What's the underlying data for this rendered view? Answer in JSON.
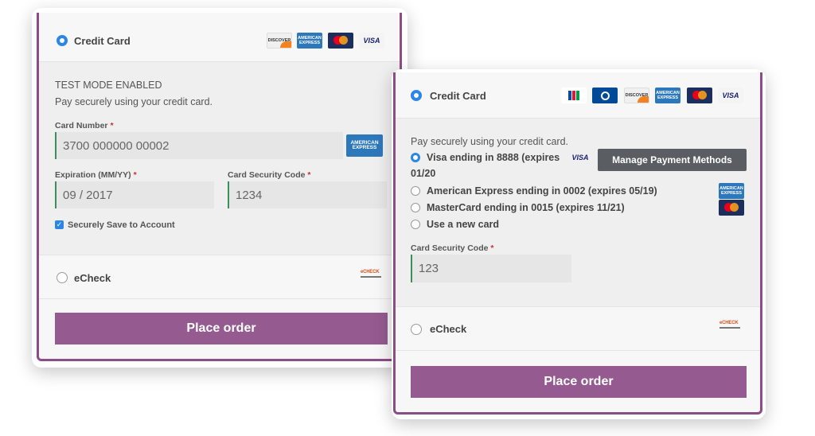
{
  "left": {
    "method_label": "Credit Card",
    "card_logos": [
      "DISCOVER",
      "AMERICAN EXPRESS",
      "",
      "VISA"
    ],
    "test_mode": "TEST MODE ENABLED",
    "pay_securely": "Pay securely using your credit card.",
    "card_number_label": "Card Number",
    "card_number_value": "3700 000000 00002",
    "detected_logo": "AMERICAN EXPRESS",
    "expiration_label": "Expiration (MM/YY)",
    "expiration_value": "09 / 2017",
    "csc_label": "Card Security Code",
    "csc_value": "1234",
    "save_label": "Securely Save to Account",
    "echeck_label": "eCheck",
    "echeck_logo": "eCHECK",
    "place_order": "Place order"
  },
  "right": {
    "method_label": "Credit Card",
    "card_logos": [
      "JCB",
      "",
      "DISCOVER",
      "AMERICAN EXPRESS",
      "",
      "VISA"
    ],
    "pay_securely": "Pay securely using your credit card.",
    "saved_methods": [
      {
        "label": "Visa ending in 8888 (expires",
        "label_cont": "01/20",
        "logo": "VISA",
        "selected": true
      },
      {
        "label": "American Express ending in 0002 (expires 05/19)",
        "logo": "AMERICAN EXPRESS",
        "selected": false
      },
      {
        "label": "MasterCard ending in 0015 (expires 11/21)",
        "logo": "",
        "selected": false
      },
      {
        "label": "Use a new card",
        "selected": false
      }
    ],
    "manage_button": "Manage Payment Methods",
    "csc_label": "Card Security Code",
    "csc_value": "123",
    "echeck_label": "eCheck",
    "echeck_logo": "eCHECK",
    "place_order": "Place order"
  },
  "required_mark": "*"
}
